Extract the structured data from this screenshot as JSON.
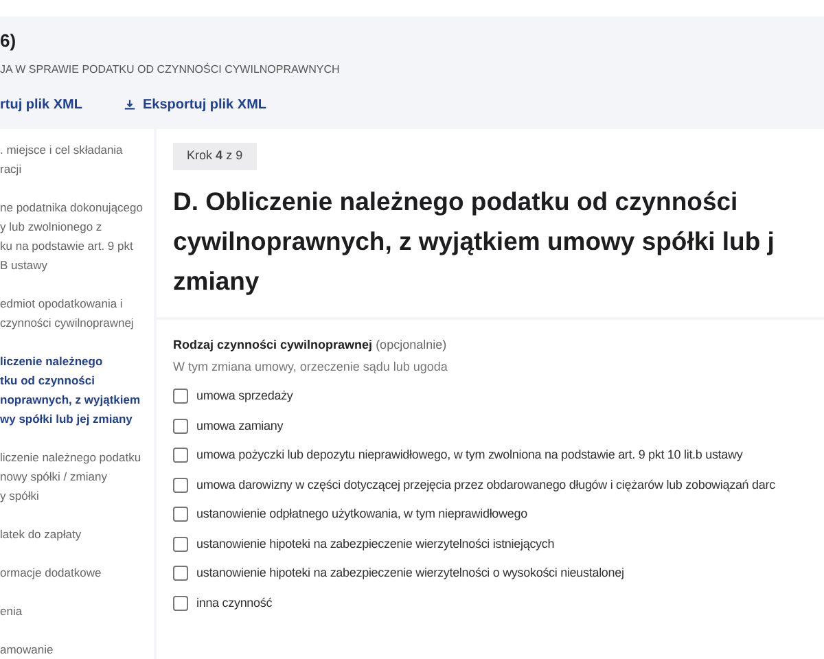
{
  "header": {
    "title": "6)",
    "subtitle": "JA W SPRAWIE PODATKU OD CZYNNOŚCI CYWILNOPRAWNYCH",
    "actions": [
      {
        "label": "rtuj plik XML",
        "kind": "text"
      },
      {
        "label": "Eksportuj plik XML",
        "kind": "download"
      }
    ]
  },
  "sidebar": {
    "items": [
      {
        "lines": [
          ". miejsce i cel składania",
          "racji"
        ],
        "selected": false
      },
      {
        "lines": [
          "ne podatnika dokonującego",
          "y lub zwolnionego z",
          "ku na podstawie art. 9 pkt",
          "B ustawy"
        ],
        "selected": false
      },
      {
        "lines": [
          "edmiot opodatkowania i",
          "czynności cywilnoprawnej"
        ],
        "selected": false
      },
      {
        "lines": [
          "liczenie należnego",
          "tku od czynności",
          "noprawnych, z wyjątkiem",
          "wy spółki lub jej zmiany"
        ],
        "selected": true
      },
      {
        "lines": [
          "liczenie należnego podatku",
          "nowy spółki / zmiany",
          "y spółki"
        ],
        "selected": false
      },
      {
        "lines": [
          "latek do zapłaty"
        ],
        "selected": false
      },
      {
        "lines": [
          "ormacje dodatkowe"
        ],
        "selected": false
      },
      {
        "lines": [
          "enia"
        ],
        "selected": false
      },
      {
        "lines": [
          "amowanie"
        ],
        "selected": false
      }
    ]
  },
  "step": {
    "prefix": "Krok",
    "current": "4",
    "suffix": "z 9"
  },
  "heading_lines": [
    "D. Obliczenie należnego podatku od czynności",
    "cywilnoprawnych, z wyjątkiem umowy spółki lub j",
    "zmiany"
  ],
  "field": {
    "label": "Rodzaj czynności cywilnoprawnej",
    "optional": "(opcjonalnie)",
    "hint": "W tym zmiana umowy, orzeczenie sądu lub ugoda",
    "options": [
      {
        "label": "umowa sprzedaży",
        "checked": false
      },
      {
        "label": "umowa zamiany",
        "checked": false
      },
      {
        "label": "umowa pożyczki lub depozytu nieprawidłowego, w tym zwolniona na podstawie art. 9 pkt 10 lit.b ustawy",
        "checked": false
      },
      {
        "label": "umowa darowizny w części dotyczącej przejęcia przez obdarowanego długów i ciężarów lub zobowiązań darc",
        "checked": false
      },
      {
        "label": "ustanowienie odpłatnego użytkowania, w tym nieprawidłowego",
        "checked": false
      },
      {
        "label": "ustanowienie hipoteki na zabezpieczenie wierzytelności istniejących",
        "checked": false
      },
      {
        "label": "ustanowienie hipoteki na zabezpieczenie wierzytelności o wysokości nieustalonej",
        "checked": false
      },
      {
        "label": "inna czynność",
        "checked": false
      }
    ]
  }
}
